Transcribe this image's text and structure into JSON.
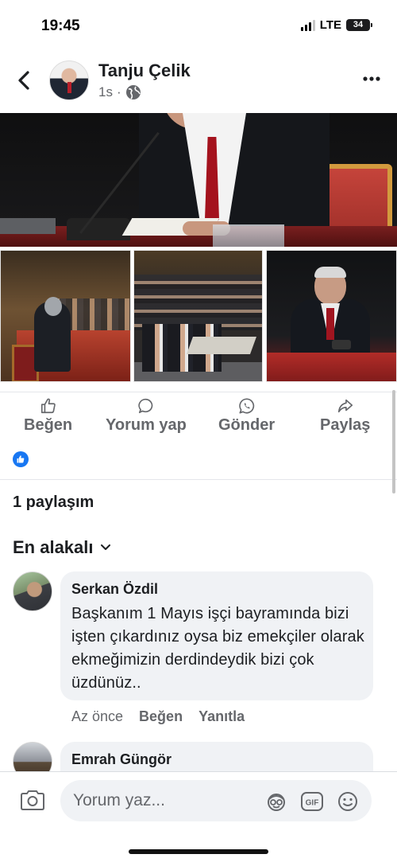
{
  "status_bar": {
    "time": "19:45",
    "network": "LTE",
    "battery": "34"
  },
  "post": {
    "author": "Tanju Çelik",
    "time": "1s",
    "separator": "·"
  },
  "actions": {
    "like": "Beğen",
    "comment": "Yorum yap",
    "send": "Gönder",
    "share": "Paylaş"
  },
  "stats": {
    "shares": "1 paylaşım"
  },
  "sort": {
    "label": "En alakalı"
  },
  "comments": [
    {
      "author": "Serkan Özdil",
      "text": "Başkanım 1 Mayıs işçi bayramında bizi işten çıkardınız oysa biz emekçiler olarak ekmeğimizin derdindeydik bizi çok üzdünüz..",
      "time": "Az önce",
      "like": "Beğen",
      "reply": "Yanıtla"
    },
    {
      "author": "Emrah Güngör"
    }
  ],
  "composer": {
    "placeholder": "Yorum yaz..."
  },
  "colors": {
    "accent": "#1877f2",
    "secondary_text": "#65676b",
    "bubble": "#f0f2f5"
  },
  "icons": [
    "back-icon",
    "more-icon",
    "globe-icon",
    "like-icon",
    "comment-icon",
    "whatsapp-icon",
    "share-icon",
    "like-reaction-icon",
    "chevron-down-icon",
    "camera-icon",
    "avatar-sticker-icon",
    "gif-icon",
    "emoji-icon"
  ]
}
